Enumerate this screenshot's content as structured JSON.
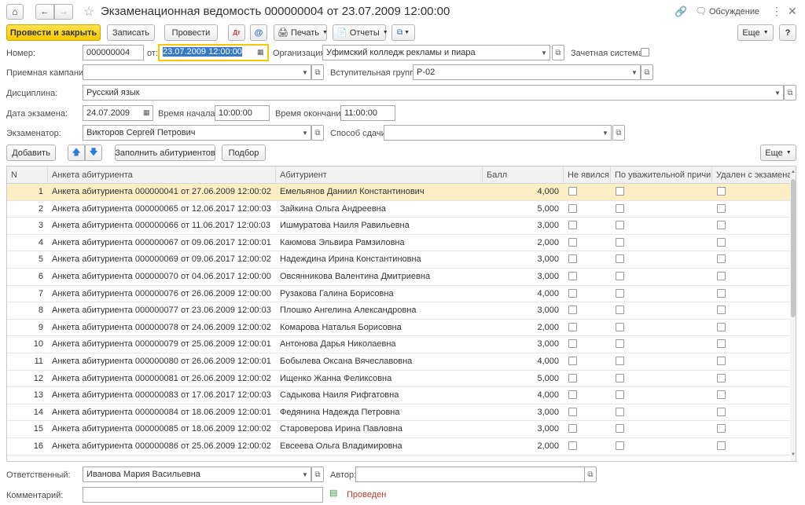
{
  "window": {
    "title": "Экзаменационная ведомость 000000004 от 23.07.2009 12:00:00",
    "discussion_label": "Обсуждение"
  },
  "toolbar": {
    "post_and_close": "Провести и закрыть",
    "save": "Записать",
    "post": "Провести",
    "print": "Печать",
    "reports": "Отчеты",
    "more": "Еще",
    "help": "?"
  },
  "form": {
    "number_label": "Номер:",
    "number_value": "000000004",
    "from_label": "от:",
    "date_value": "23.07.2009 12:00:00",
    "org_label": "Организация:",
    "org_value": "Уфимский колледж рекламы и пиара",
    "credit_system_label": "Зачетная система:",
    "campaign_label": "Приемная кампания:",
    "campaign_value": "",
    "entry_group_label": "Вступительная группа:",
    "entry_group_value": "Р-02",
    "discipline_label": "Дисциплина:",
    "discipline_value": "Русский язык",
    "exam_date_label": "Дата экзамена:",
    "exam_date_value": "24.07.2009",
    "start_time_label": "Время начала:",
    "start_time_value": "10:00:00",
    "end_time_label": "Время окончания:",
    "end_time_value": "11:00:00",
    "examiner_label": "Экзаменатор:",
    "examiner_value": "Викторов Сергей Петрович",
    "method_label": "Способ сдачи:",
    "method_value": ""
  },
  "table_toolbar": {
    "add": "Добавить",
    "fill": "Заполнить абитуриентов",
    "pick": "Подбор",
    "more": "Еще"
  },
  "table": {
    "columns": [
      "N",
      "Анкета абитуриента",
      "Абитуриент",
      "Балл",
      "Не явился",
      "По уважительной причине",
      "Удален с экзамена"
    ],
    "rows": [
      {
        "n": "1",
        "form": "Анкета абитуриента 000000041 от 27.06.2009 12:00:02",
        "name": "Емельянов Даниил Константинович",
        "score": "4,000"
      },
      {
        "n": "2",
        "form": "Анкета абитуриента 000000065 от 12.06.2017 12:00:03",
        "name": "Зайкина Ольга Андреевна",
        "score": "5,000"
      },
      {
        "n": "3",
        "form": "Анкета абитуриента 000000066 от 11.06.2017 12:00:03",
        "name": "Ишмуратова Наиля Равильевна",
        "score": "3,000"
      },
      {
        "n": "4",
        "form": "Анкета абитуриента 000000067 от 09.06.2017 12:00:01",
        "name": "Каюмова Эльвира Рамзиловна",
        "score": "2,000"
      },
      {
        "n": "5",
        "form": "Анкета абитуриента 000000069 от 09.06.2017 12:00:02",
        "name": "Надеждина Ирина Константиновна",
        "score": "3,000"
      },
      {
        "n": "6",
        "form": "Анкета абитуриента 000000070 от 04.06.2017 12:00:00",
        "name": "Овсянникова Валентина Дмитриевна",
        "score": "3,000"
      },
      {
        "n": "7",
        "form": "Анкета абитуриента 000000076 от 26.06.2009 12:00:00",
        "name": "Рузакова Галина Борисовна",
        "score": "4,000"
      },
      {
        "n": "8",
        "form": "Анкета абитуриента 000000077 от 23.06.2009 12:00:03",
        "name": "Плошко Ангелина Александровна",
        "score": "3,000"
      },
      {
        "n": "9",
        "form": "Анкета абитуриента 000000078 от 24.06.2009 12:00:02",
        "name": "Комарова Наталья Борисовна",
        "score": "2,000"
      },
      {
        "n": "10",
        "form": "Анкета абитуриента 000000079 от 25.06.2009 12:00:01",
        "name": "Антонова Дарья Николаевна",
        "score": "3,000"
      },
      {
        "n": "11",
        "form": "Анкета абитуриента 000000080 от 26.06.2009 12:00:01",
        "name": "Бобылева Оксана Вячеславовна",
        "score": "4,000"
      },
      {
        "n": "12",
        "form": "Анкета абитуриента 000000081 от 26.06.2009 12:00:02",
        "name": "Ищенко Жанна Феликсовна",
        "score": "5,000"
      },
      {
        "n": "13",
        "form": "Анкета абитуриента 000000083 от 17.06.2017 12:00:03",
        "name": "Садыкова  Наиля Рифгатовна",
        "score": "4,000"
      },
      {
        "n": "14",
        "form": "Анкета абитуриента 000000084 от 18.06.2009 12:00:01",
        "name": "Федянина Надежда Петровна",
        "score": "3,000"
      },
      {
        "n": "15",
        "form": "Анкета абитуриента 000000085 от 18.06.2009 12:00:02",
        "name": "Староверова Ирина Павловна",
        "score": "3,000"
      },
      {
        "n": "16",
        "form": "Анкета абитуриента 000000086 от 25.06.2009 12:00:02",
        "name": "Евсеева Ольга Владимировна",
        "score": "2,000"
      }
    ]
  },
  "footer": {
    "responsible_label": "Ответственный:",
    "responsible_value": "Иванова Мария Васильевна",
    "author_label": "Автор:",
    "author_value": "",
    "comment_label": "Комментарий:",
    "comment_value": "",
    "status": "Проведен"
  },
  "colors": {
    "accent": "#f5c800",
    "selected_row": "#fbedc4",
    "status_text": "#c0392b"
  }
}
